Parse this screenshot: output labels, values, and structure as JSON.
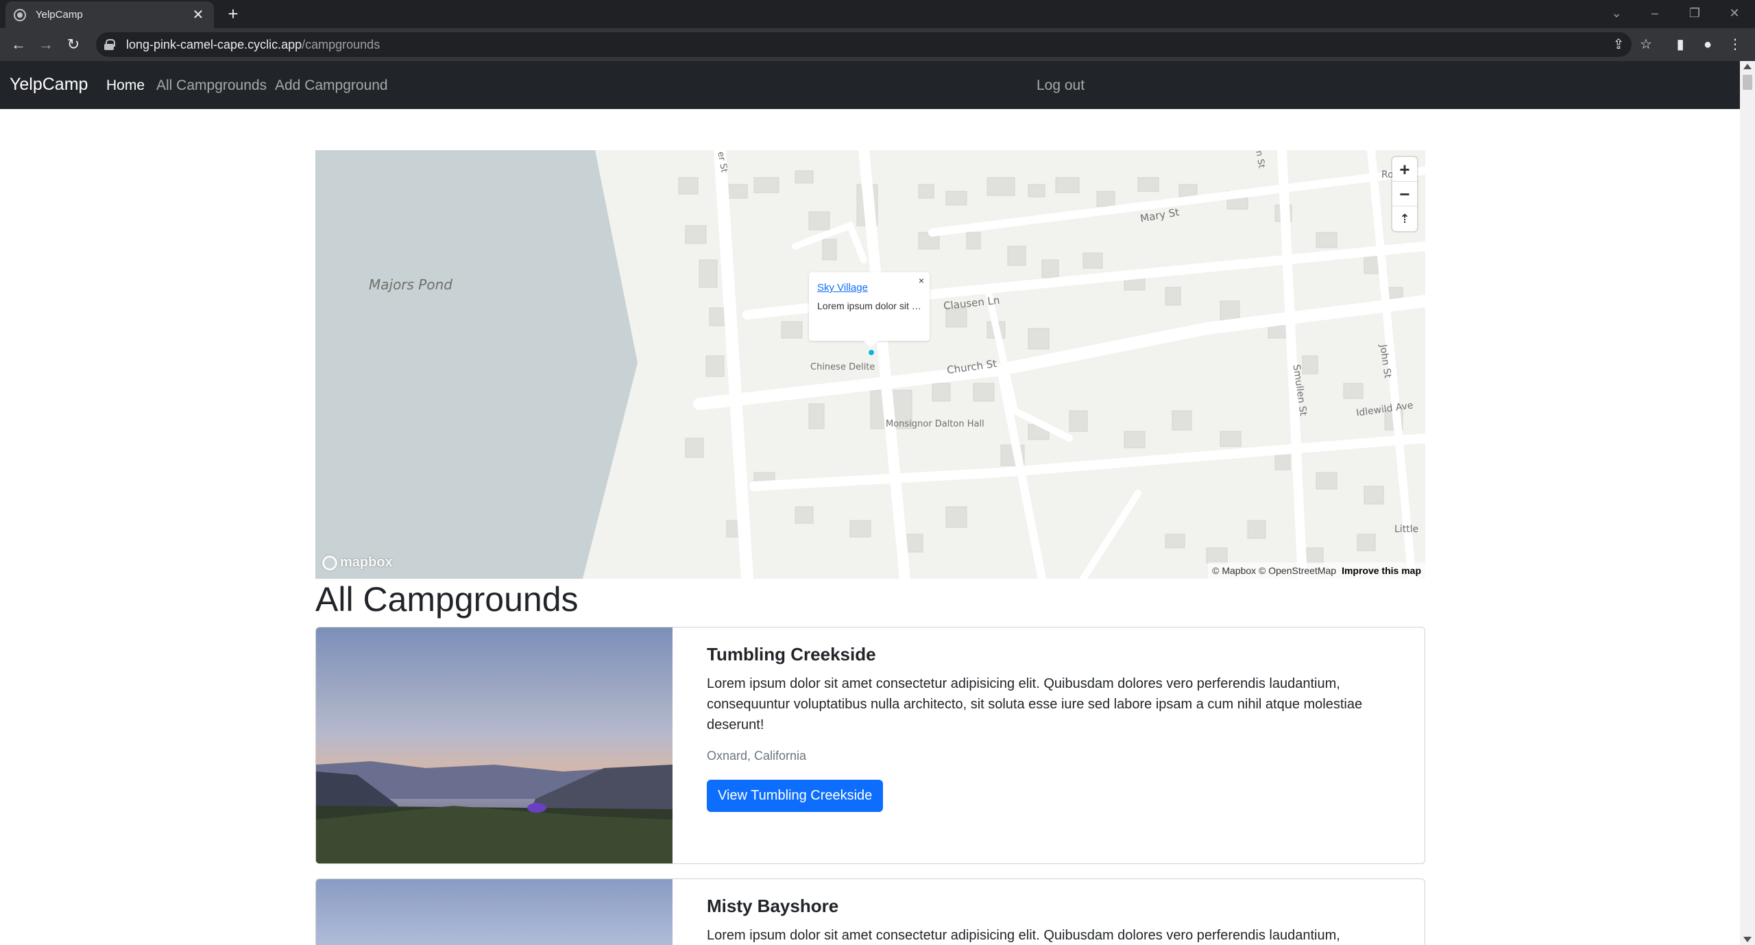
{
  "browser": {
    "tab_title": "YelpCamp",
    "tab_close": "✕",
    "new_tab": "+",
    "url_host": "long-pink-camel-cape.cyclic.app",
    "url_path": "/campgrounds",
    "back": "←",
    "forward": "→",
    "reload": "↻",
    "window_controls": [
      "⌄",
      "–",
      "❐",
      "✕"
    ]
  },
  "navbar": {
    "brand": "YelpCamp",
    "links": [
      "Home",
      "All Campgrounds",
      "Add Campground"
    ],
    "logout": "Log out"
  },
  "map": {
    "labels": {
      "pond": "Majors Pond",
      "mary": "Mary St",
      "clausen": "Clausen Ln",
      "church": "Church St",
      "chinese": "Chinese Delite",
      "hall": "Monsignor Dalton Hall",
      "smullen": "Smullen St",
      "john": "John St",
      "idlewild": "Idlewild Ave",
      "little": "Little",
      "ro": "Ro",
      "er_st": "er St",
      "n_st": "n St"
    },
    "zoom_in": "+",
    "zoom_out": "−",
    "compass": "⇡",
    "popup": {
      "title": "Sky Village",
      "text": "Lorem ipsum dolor sit amet consectetur",
      "close": "×"
    },
    "logo": "mapbox",
    "attribution_1": "© Mapbox © OpenStreetMap",
    "attribution_2": "Improve this map",
    "colors": {
      "water": "#c8d1d3",
      "land": "#f2f2ef",
      "building": "#e0e0dd",
      "road": "#ffffff"
    }
  },
  "page_title": "All Campgrounds",
  "campgrounds": [
    {
      "title": "Tumbling Creekside",
      "description": "Lorem ipsum dolor sit amet consectetur adipisicing elit. Quibusdam dolores vero perferendis laudantium, consequuntur voluptatibus nulla architecto, sit soluta esse iure sed labore ipsam a cum nihil atque molestiae deserunt!",
      "location": "Oxnard, California",
      "button": "View Tumbling Creekside"
    },
    {
      "title": "Misty Bayshore",
      "description": "Lorem ipsum dolor sit amet consectetur adipisicing elit. Quibusdam dolores vero perferendis laudantium,",
      "location": "",
      "button": ""
    }
  ]
}
